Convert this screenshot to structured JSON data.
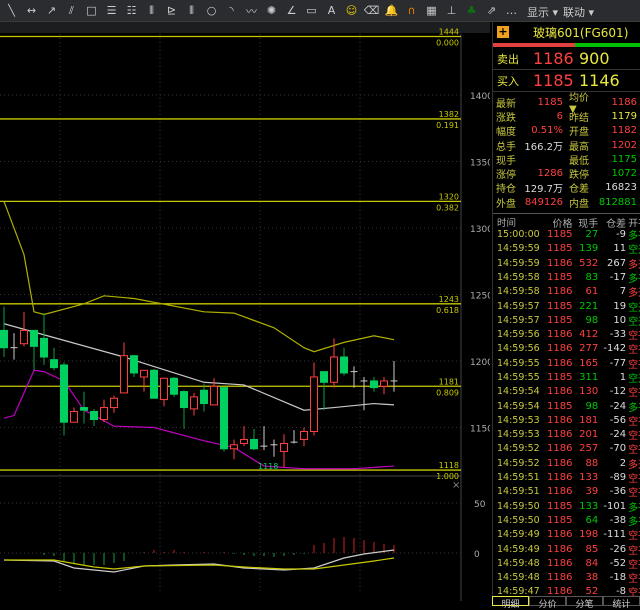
{
  "toolbar": {
    "icons": [
      "line-icon",
      "horizontal-line-icon",
      "ray-icon",
      "parallel-icon",
      "rectangle-icon",
      "fib-icon",
      "fib-ext-icon",
      "cycle-icon",
      "gann-icon",
      "period-icon",
      "circle-icon",
      "arc-icon",
      "wave-icon",
      "fan-icon",
      "angle-icon",
      "ruler-icon",
      "text-icon",
      "smile-icon",
      "eraser-icon",
      "bell-icon",
      "magnet-icon",
      "grid-icon",
      "split-icon",
      "clover-icon",
      "export-icon",
      "more-icon"
    ],
    "menus": {
      "display": "显示",
      "link": "联动"
    }
  },
  "chart": {
    "fib": [
      {
        "price": "1444",
        "ratio": "0.000"
      },
      {
        "price": "1382",
        "ratio": "0.191"
      },
      {
        "price": "1320",
        "ratio": "0.382"
      },
      {
        "price": "1243",
        "ratio": "0.618"
      },
      {
        "price": "1181",
        "ratio": "0.809"
      },
      {
        "price": "1118",
        "ratio": "1.000"
      }
    ],
    "low_marker": "1118",
    "osc_ticks": [
      "50",
      "0"
    ],
    "tabs_top": [
      "3"
    ]
  },
  "chart_data": {
    "type": "candlestick",
    "ylim": [
      1118,
      1444
    ],
    "yticks": [
      1400,
      1350,
      1300,
      1250,
      1200,
      1150
    ],
    "candles": [
      [
        1223,
        1210,
        1241,
        1203
      ],
      [
        1210,
        1210,
        1221,
        1201
      ],
      [
        1213,
        1223,
        1237,
        1211
      ],
      [
        1223,
        1211,
        1223,
        1193
      ],
      [
        1217,
        1203,
        1236,
        1197
      ],
      [
        1201,
        1195,
        1210,
        1193
      ],
      [
        1197,
        1154,
        1199,
        1144
      ],
      [
        1154,
        1162,
        1165,
        1154
      ],
      [
        1165,
        1163,
        1177,
        1153
      ],
      [
        1162,
        1156,
        1164,
        1151
      ],
      [
        1156,
        1165,
        1171,
        1154
      ],
      [
        1165,
        1172,
        1174,
        1161
      ],
      [
        1176,
        1204,
        1214,
        1176
      ],
      [
        1204,
        1191,
        1204,
        1188
      ],
      [
        1188,
        1193,
        1193,
        1177
      ],
      [
        1193,
        1172,
        1194,
        1172
      ],
      [
        1171,
        1187,
        1187,
        1166
      ],
      [
        1187,
        1175,
        1188,
        1173
      ],
      [
        1177,
        1165,
        1178,
        1149
      ],
      [
        1164,
        1173,
        1176,
        1159
      ],
      [
        1178,
        1168,
        1183,
        1162
      ],
      [
        1167,
        1181,
        1187,
        1167
      ],
      [
        1180,
        1134,
        1180,
        1132
      ],
      [
        1134,
        1137,
        1141,
        1126
      ],
      [
        1138,
        1141,
        1151,
        1136
      ],
      [
        1141,
        1134,
        1149,
        1133
      ],
      [
        1136,
        1136,
        1151,
        1133
      ],
      [
        1137,
        1137,
        1141,
        1128
      ],
      [
        1132,
        1138,
        1145,
        1120
      ],
      [
        1139,
        1139,
        1148,
        1138
      ],
      [
        1141,
        1147,
        1150,
        1136
      ],
      [
        1147,
        1188,
        1199,
        1144
      ],
      [
        1192,
        1184,
        1192,
        1163
      ],
      [
        1184,
        1203,
        1217,
        1180
      ],
      [
        1203,
        1191,
        1210,
        1189
      ],
      [
        1192,
        1192,
        1196,
        1180
      ],
      [
        1185,
        1185,
        1188,
        1163
      ],
      [
        1185,
        1180,
        1188,
        1177
      ],
      [
        1181,
        1185,
        1188,
        1175
      ],
      [
        1185,
        1185,
        1200,
        1177
      ]
    ],
    "ma_white": [
      [
        0,
        1228
      ],
      [
        12,
        1203
      ],
      [
        20,
        1184
      ],
      [
        24,
        1182
      ],
      [
        30,
        1163
      ],
      [
        33,
        1165
      ],
      [
        37,
        1168
      ],
      [
        39,
        1167
      ]
    ],
    "ma_magenta": [
      [
        0,
        1157
      ],
      [
        1,
        1159
      ],
      [
        3,
        1193
      ],
      [
        4,
        1192
      ],
      [
        6,
        1185
      ],
      [
        8,
        1163
      ],
      [
        11,
        1151
      ],
      [
        15,
        1150
      ],
      [
        20,
        1140
      ],
      [
        23,
        1135
      ],
      [
        26,
        1121
      ],
      [
        30,
        1119
      ],
      [
        35,
        1119
      ],
      [
        39,
        1121
      ]
    ],
    "ma_yellow": [
      [
        0,
        1320
      ],
      [
        2,
        1280
      ],
      [
        3,
        1237
      ],
      [
        4,
        1235
      ],
      [
        8,
        1243
      ],
      [
        10,
        1249
      ],
      [
        13,
        1247
      ],
      [
        20,
        1237
      ],
      [
        23,
        1236
      ],
      [
        27,
        1225
      ],
      [
        30,
        1210
      ],
      [
        31,
        1207
      ],
      [
        34,
        1214
      ],
      [
        37,
        1219
      ],
      [
        39,
        1216
      ]
    ],
    "osc_hist": [
      0,
      0,
      0,
      0,
      -2,
      -3,
      -8,
      -10,
      -12,
      -12,
      -12,
      -10,
      -8,
      0,
      1,
      3,
      1,
      3,
      1,
      0,
      1,
      0,
      1,
      -1,
      -2,
      -3,
      -3,
      -4,
      -3,
      -2,
      -1,
      8,
      10,
      15,
      16,
      15,
      13,
      11,
      9,
      8
    ],
    "osc_white": [
      [
        0,
        -7
      ],
      [
        5,
        -8
      ],
      [
        7,
        -15
      ],
      [
        11,
        -19
      ],
      [
        14,
        -13
      ],
      [
        17,
        -12
      ],
      [
        21,
        -11
      ],
      [
        24,
        -15
      ],
      [
        28,
        -17
      ],
      [
        31,
        -15
      ],
      [
        34,
        -5
      ],
      [
        36,
        -1
      ],
      [
        39,
        3
      ]
    ],
    "osc_yellow": [
      [
        0,
        -7
      ],
      [
        5,
        -7
      ],
      [
        9,
        -14
      ],
      [
        11,
        -16
      ],
      [
        14,
        -13
      ],
      [
        21,
        -12
      ],
      [
        24,
        -14
      ],
      [
        28,
        -16
      ],
      [
        31,
        -16
      ],
      [
        34,
        -12
      ],
      [
        37,
        -8
      ],
      [
        39,
        -5
      ]
    ]
  },
  "panel": {
    "title": "玻璃601(FG601)",
    "sell": {
      "label": "卖出",
      "price": "1186",
      "vol": "900"
    },
    "buy": {
      "label": "买入",
      "price": "1185",
      "vol": "1146"
    },
    "stats": [
      {
        "k": "最新",
        "v": "1185",
        "vc": "red",
        "k2": "均价▼",
        "v2": "1186",
        "v2c": "red"
      },
      {
        "k": "涨跌",
        "v": "6",
        "vc": "red",
        "k2": "昨结",
        "v2": "1179",
        "v2c": "yel"
      },
      {
        "k": "幅度",
        "v": "0.51%",
        "vc": "red",
        "k2": "开盘",
        "v2": "1182",
        "v2c": "red"
      },
      {
        "k": "总手",
        "v": "166.2万",
        "vc": "wht",
        "k2": "最高",
        "v2": "1202",
        "v2c": "red"
      },
      {
        "k": "现手",
        "v": "",
        "vc": "wht",
        "k2": "最低",
        "v2": "1175",
        "v2c": "green"
      },
      {
        "k": "涨停",
        "v": "1286",
        "vc": "red",
        "k2": "跌停",
        "v2": "1072",
        "v2c": "green"
      },
      {
        "k": "持仓",
        "v": "129.7万",
        "vc": "wht",
        "k2": "仓差",
        "v2": "16823",
        "v2c": "wht"
      },
      {
        "k": "外盘",
        "v": "849126",
        "vc": "red",
        "k2": "内盘",
        "v2": "812881",
        "v2c": "green"
      }
    ],
    "headers": [
      "时间",
      "价格",
      "现手",
      "仓差",
      "开平"
    ],
    "trades": [
      [
        "15:00:00",
        "1185",
        "27",
        "-9",
        "多平",
        "green"
      ],
      [
        "14:59:59",
        "1185",
        "139",
        "11",
        "空开",
        "green"
      ],
      [
        "14:59:59",
        "1186",
        "532",
        "267",
        "多开",
        "red"
      ],
      [
        "14:59:58",
        "1185",
        "83",
        "-17",
        "多平",
        "green"
      ],
      [
        "14:59:58",
        "1186",
        "61",
        "7",
        "多开",
        "red"
      ],
      [
        "14:59:57",
        "1185",
        "221",
        "19",
        "空开",
        "green"
      ],
      [
        "14:59:57",
        "1185",
        "98",
        "10",
        "空开",
        "green"
      ],
      [
        "14:59:56",
        "1186",
        "412",
        "-33",
        "空平",
        "red"
      ],
      [
        "14:59:56",
        "1186",
        "277",
        "-142",
        "空平",
        "red"
      ],
      [
        "14:59:55",
        "1186",
        "165",
        "-77",
        "空平",
        "red"
      ],
      [
        "14:59:55",
        "1185",
        "311",
        "1",
        "空开",
        "green"
      ],
      [
        "14:59:54",
        "1186",
        "130",
        "-12",
        "空平",
        "red"
      ],
      [
        "14:59:54",
        "1185",
        "98",
        "-24",
        "多平",
        "green"
      ],
      [
        "14:59:53",
        "1186",
        "181",
        "-56",
        "空平",
        "red"
      ],
      [
        "14:59:53",
        "1186",
        "201",
        "-24",
        "空平",
        "red"
      ],
      [
        "14:59:52",
        "1186",
        "257",
        "-70",
        "空平",
        "red"
      ],
      [
        "14:59:52",
        "1186",
        "88",
        "2",
        "多开",
        "red"
      ],
      [
        "14:59:51",
        "1186",
        "133",
        "-89",
        "空平",
        "red"
      ],
      [
        "14:59:51",
        "1186",
        "39",
        "-36",
        "空平",
        "red"
      ],
      [
        "14:59:50",
        "1185",
        "133",
        "-101",
        "多平",
        "green"
      ],
      [
        "14:59:50",
        "1185",
        "64",
        "-38",
        "多平",
        "green"
      ],
      [
        "14:59:49",
        "1186",
        "198",
        "-111",
        "空平",
        "red"
      ],
      [
        "14:59:49",
        "1186",
        "85",
        "-26",
        "空平",
        "red"
      ],
      [
        "14:59:48",
        "1186",
        "84",
        "-52",
        "空平",
        "red"
      ],
      [
        "14:59:48",
        "1186",
        "38",
        "-18",
        "空平",
        "red"
      ],
      [
        "14:59:47",
        "1186",
        "52",
        "-8",
        "空平",
        "red"
      ]
    ],
    "tabs": [
      "明细",
      "分价",
      "分笔",
      "统计"
    ]
  },
  "colors": {
    "up": "#ff4040",
    "down": "#00d060",
    "fib": "#c8c800",
    "ma_white": "#c8c8c8",
    "ma_magenta": "#c000c0",
    "ma_yellow": "#b0b000"
  }
}
